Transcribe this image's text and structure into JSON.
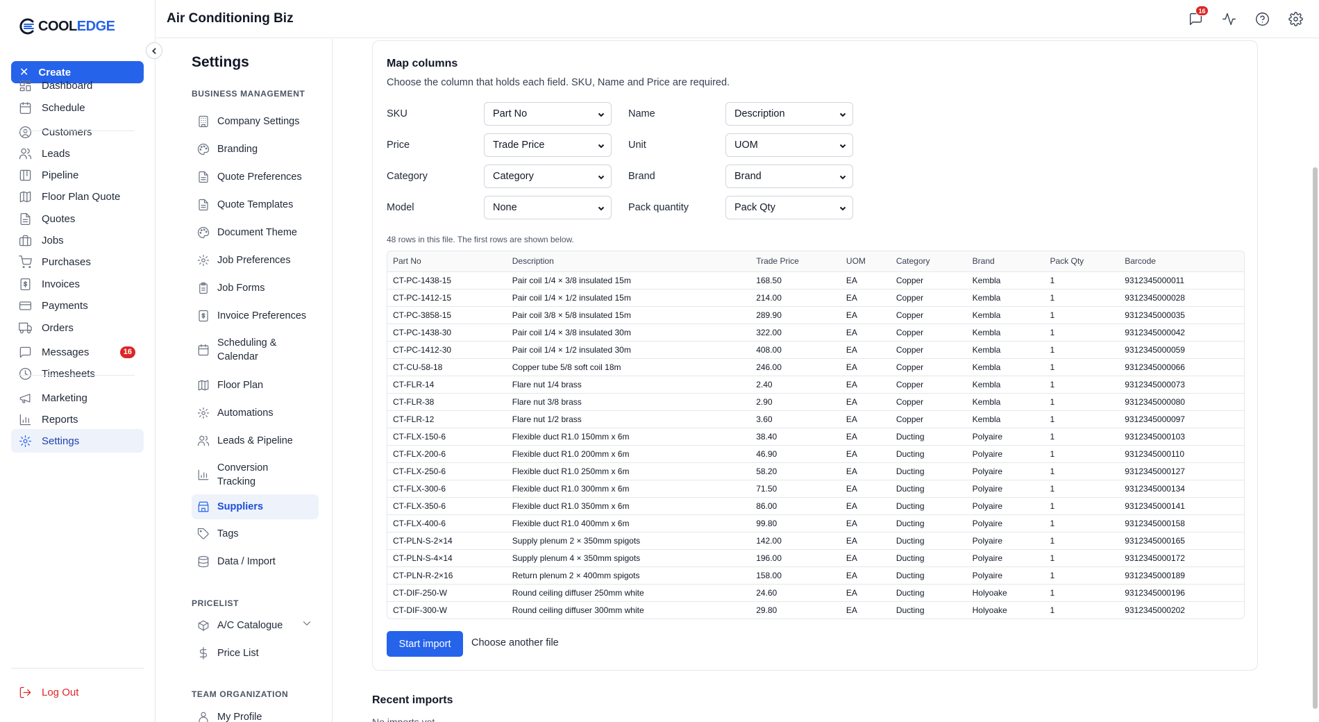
{
  "app": {
    "title": "Air Conditioning Biz"
  },
  "logo": {
    "part1": "COOL",
    "part2": "EDGE"
  },
  "sidebar": {
    "create_label": "Create",
    "items": [
      {
        "label": "Dashboard",
        "icon": "dashboard-icon"
      },
      {
        "label": "Schedule",
        "icon": "calendar-icon"
      },
      {
        "label": "Customers",
        "icon": "user-circle-icon"
      },
      {
        "label": "Leads",
        "icon": "users-icon"
      },
      {
        "label": "Pipeline",
        "icon": "pipeline-icon"
      },
      {
        "label": "Floor Plan Quote",
        "icon": "map-icon"
      },
      {
        "label": "Quotes",
        "icon": "document-icon"
      },
      {
        "label": "Jobs",
        "icon": "briefcase-icon"
      },
      {
        "label": "Purchases",
        "icon": "cart-icon"
      },
      {
        "label": "Invoices",
        "icon": "invoice-icon"
      },
      {
        "label": "Payments",
        "icon": "credit-card-icon"
      },
      {
        "label": "Orders",
        "icon": "truck-icon"
      },
      {
        "label": "Messages",
        "icon": "message-icon",
        "badge": "16"
      },
      {
        "label": "Timesheets",
        "icon": "clock-icon"
      },
      {
        "label": "Marketing",
        "icon": "megaphone-icon"
      },
      {
        "label": "Reports",
        "icon": "bar-chart-icon"
      },
      {
        "label": "Settings",
        "icon": "gear-icon",
        "active": true
      }
    ],
    "logout_label": "Log Out"
  },
  "topbar": {
    "messages_badge": "16"
  },
  "settings": {
    "title": "Settings",
    "business_heading": "BUSINESS MANAGEMENT",
    "business_items": [
      {
        "label": "Company Settings"
      },
      {
        "label": "Branding"
      },
      {
        "label": "Quote Preferences"
      },
      {
        "label": "Quote Templates"
      },
      {
        "label": "Document Theme"
      },
      {
        "label": "Job Preferences"
      },
      {
        "label": "Job Forms"
      },
      {
        "label": "Invoice Preferences"
      },
      {
        "label": "Scheduling & Calendar"
      },
      {
        "label": "Floor Plan"
      },
      {
        "label": "Automations"
      },
      {
        "label": "Leads & Pipeline"
      },
      {
        "label": "Conversion Tracking"
      },
      {
        "label": "Suppliers",
        "active": true
      },
      {
        "label": "Tags"
      },
      {
        "label": "Data / Import"
      }
    ],
    "pricelist_heading": "PRICELIST",
    "pricelist_items": [
      {
        "label": "A/C Catalogue"
      },
      {
        "label": "Price List"
      }
    ],
    "team_heading": "TEAM ORGANIZATION",
    "team_items": [
      {
        "label": "My Profile"
      }
    ]
  },
  "map": {
    "title": "Map columns",
    "subtitle": "Choose the column that holds each field. SKU, Name and Price are required.",
    "fields": [
      {
        "label": "SKU",
        "value": "Part No"
      },
      {
        "label": "Name",
        "value": "Description"
      },
      {
        "label": "Price",
        "value": "Trade Price"
      },
      {
        "label": "Unit",
        "value": "UOM"
      },
      {
        "label": "Category",
        "value": "Category"
      },
      {
        "label": "Brand",
        "value": "Brand"
      },
      {
        "label": "Model",
        "value": "None"
      },
      {
        "label": "Pack quantity",
        "value": "Pack Qty"
      }
    ],
    "rows_info": "48 rows in this file. The first rows are shown below.",
    "columns": [
      "Part No",
      "Description",
      "Trade Price",
      "UOM",
      "Category",
      "Brand",
      "Pack Qty",
      "Barcode"
    ],
    "rows": [
      [
        "CT-PC-1438-15",
        "Pair coil 1/4 × 3/8 insulated 15m",
        "168.50",
        "EA",
        "Copper",
        "Kembla",
        "1",
        "9312345000011"
      ],
      [
        "CT-PC-1412-15",
        "Pair coil 1/4 × 1/2 insulated 15m",
        "214.00",
        "EA",
        "Copper",
        "Kembla",
        "1",
        "9312345000028"
      ],
      [
        "CT-PC-3858-15",
        "Pair coil 3/8 × 5/8 insulated 15m",
        "289.90",
        "EA",
        "Copper",
        "Kembla",
        "1",
        "9312345000035"
      ],
      [
        "CT-PC-1438-30",
        "Pair coil 1/4 × 3/8 insulated 30m",
        "322.00",
        "EA",
        "Copper",
        "Kembla",
        "1",
        "9312345000042"
      ],
      [
        "CT-PC-1412-30",
        "Pair coil 1/4 × 1/2 insulated 30m",
        "408.00",
        "EA",
        "Copper",
        "Kembla",
        "1",
        "9312345000059"
      ],
      [
        "CT-CU-58-18",
        "Copper tube 5/8 soft coil 18m",
        "246.00",
        "EA",
        "Copper",
        "Kembla",
        "1",
        "9312345000066"
      ],
      [
        "CT-FLR-14",
        "Flare nut 1/4 brass",
        "2.40",
        "EA",
        "Copper",
        "Kembla",
        "1",
        "9312345000073"
      ],
      [
        "CT-FLR-38",
        "Flare nut 3/8 brass",
        "2.90",
        "EA",
        "Copper",
        "Kembla",
        "1",
        "9312345000080"
      ],
      [
        "CT-FLR-12",
        "Flare nut 1/2 brass",
        "3.60",
        "EA",
        "Copper",
        "Kembla",
        "1",
        "9312345000097"
      ],
      [
        "CT-FLX-150-6",
        "Flexible duct R1.0 150mm x 6m",
        "38.40",
        "EA",
        "Ducting",
        "Polyaire",
        "1",
        "9312345000103"
      ],
      [
        "CT-FLX-200-6",
        "Flexible duct R1.0 200mm x 6m",
        "46.90",
        "EA",
        "Ducting",
        "Polyaire",
        "1",
        "9312345000110"
      ],
      [
        "CT-FLX-250-6",
        "Flexible duct R1.0 250mm x 6m",
        "58.20",
        "EA",
        "Ducting",
        "Polyaire",
        "1",
        "9312345000127"
      ],
      [
        "CT-FLX-300-6",
        "Flexible duct R1.0 300mm x 6m",
        "71.50",
        "EA",
        "Ducting",
        "Polyaire",
        "1",
        "9312345000134"
      ],
      [
        "CT-FLX-350-6",
        "Flexible duct R1.0 350mm x 6m",
        "86.00",
        "EA",
        "Ducting",
        "Polyaire",
        "1",
        "9312345000141"
      ],
      [
        "CT-FLX-400-6",
        "Flexible duct R1.0 400mm x 6m",
        "99.80",
        "EA",
        "Ducting",
        "Polyaire",
        "1",
        "9312345000158"
      ],
      [
        "CT-PLN-S-2×14",
        "Supply plenum 2 × 350mm spigots",
        "142.00",
        "EA",
        "Ducting",
        "Polyaire",
        "1",
        "9312345000165"
      ],
      [
        "CT-PLN-S-4×14",
        "Supply plenum 4 × 350mm spigots",
        "196.00",
        "EA",
        "Ducting",
        "Polyaire",
        "1",
        "9312345000172"
      ],
      [
        "CT-PLN-R-2×16",
        "Return plenum 2 × 400mm spigots",
        "158.00",
        "EA",
        "Ducting",
        "Polyaire",
        "1",
        "9312345000189"
      ],
      [
        "CT-DIF-250-W",
        "Round ceiling diffuser 250mm white",
        "24.60",
        "EA",
        "Ducting",
        "Holyoake",
        "1",
        "9312345000196"
      ],
      [
        "CT-DIF-300-W",
        "Round ceiling diffuser 300mm white",
        "29.80",
        "EA",
        "Ducting",
        "Holyoake",
        "1",
        "9312345000202"
      ]
    ],
    "start_label": "Start import",
    "choose_label": "Choose another file"
  },
  "recent": {
    "title": "Recent imports",
    "empty": "No imports yet"
  }
}
